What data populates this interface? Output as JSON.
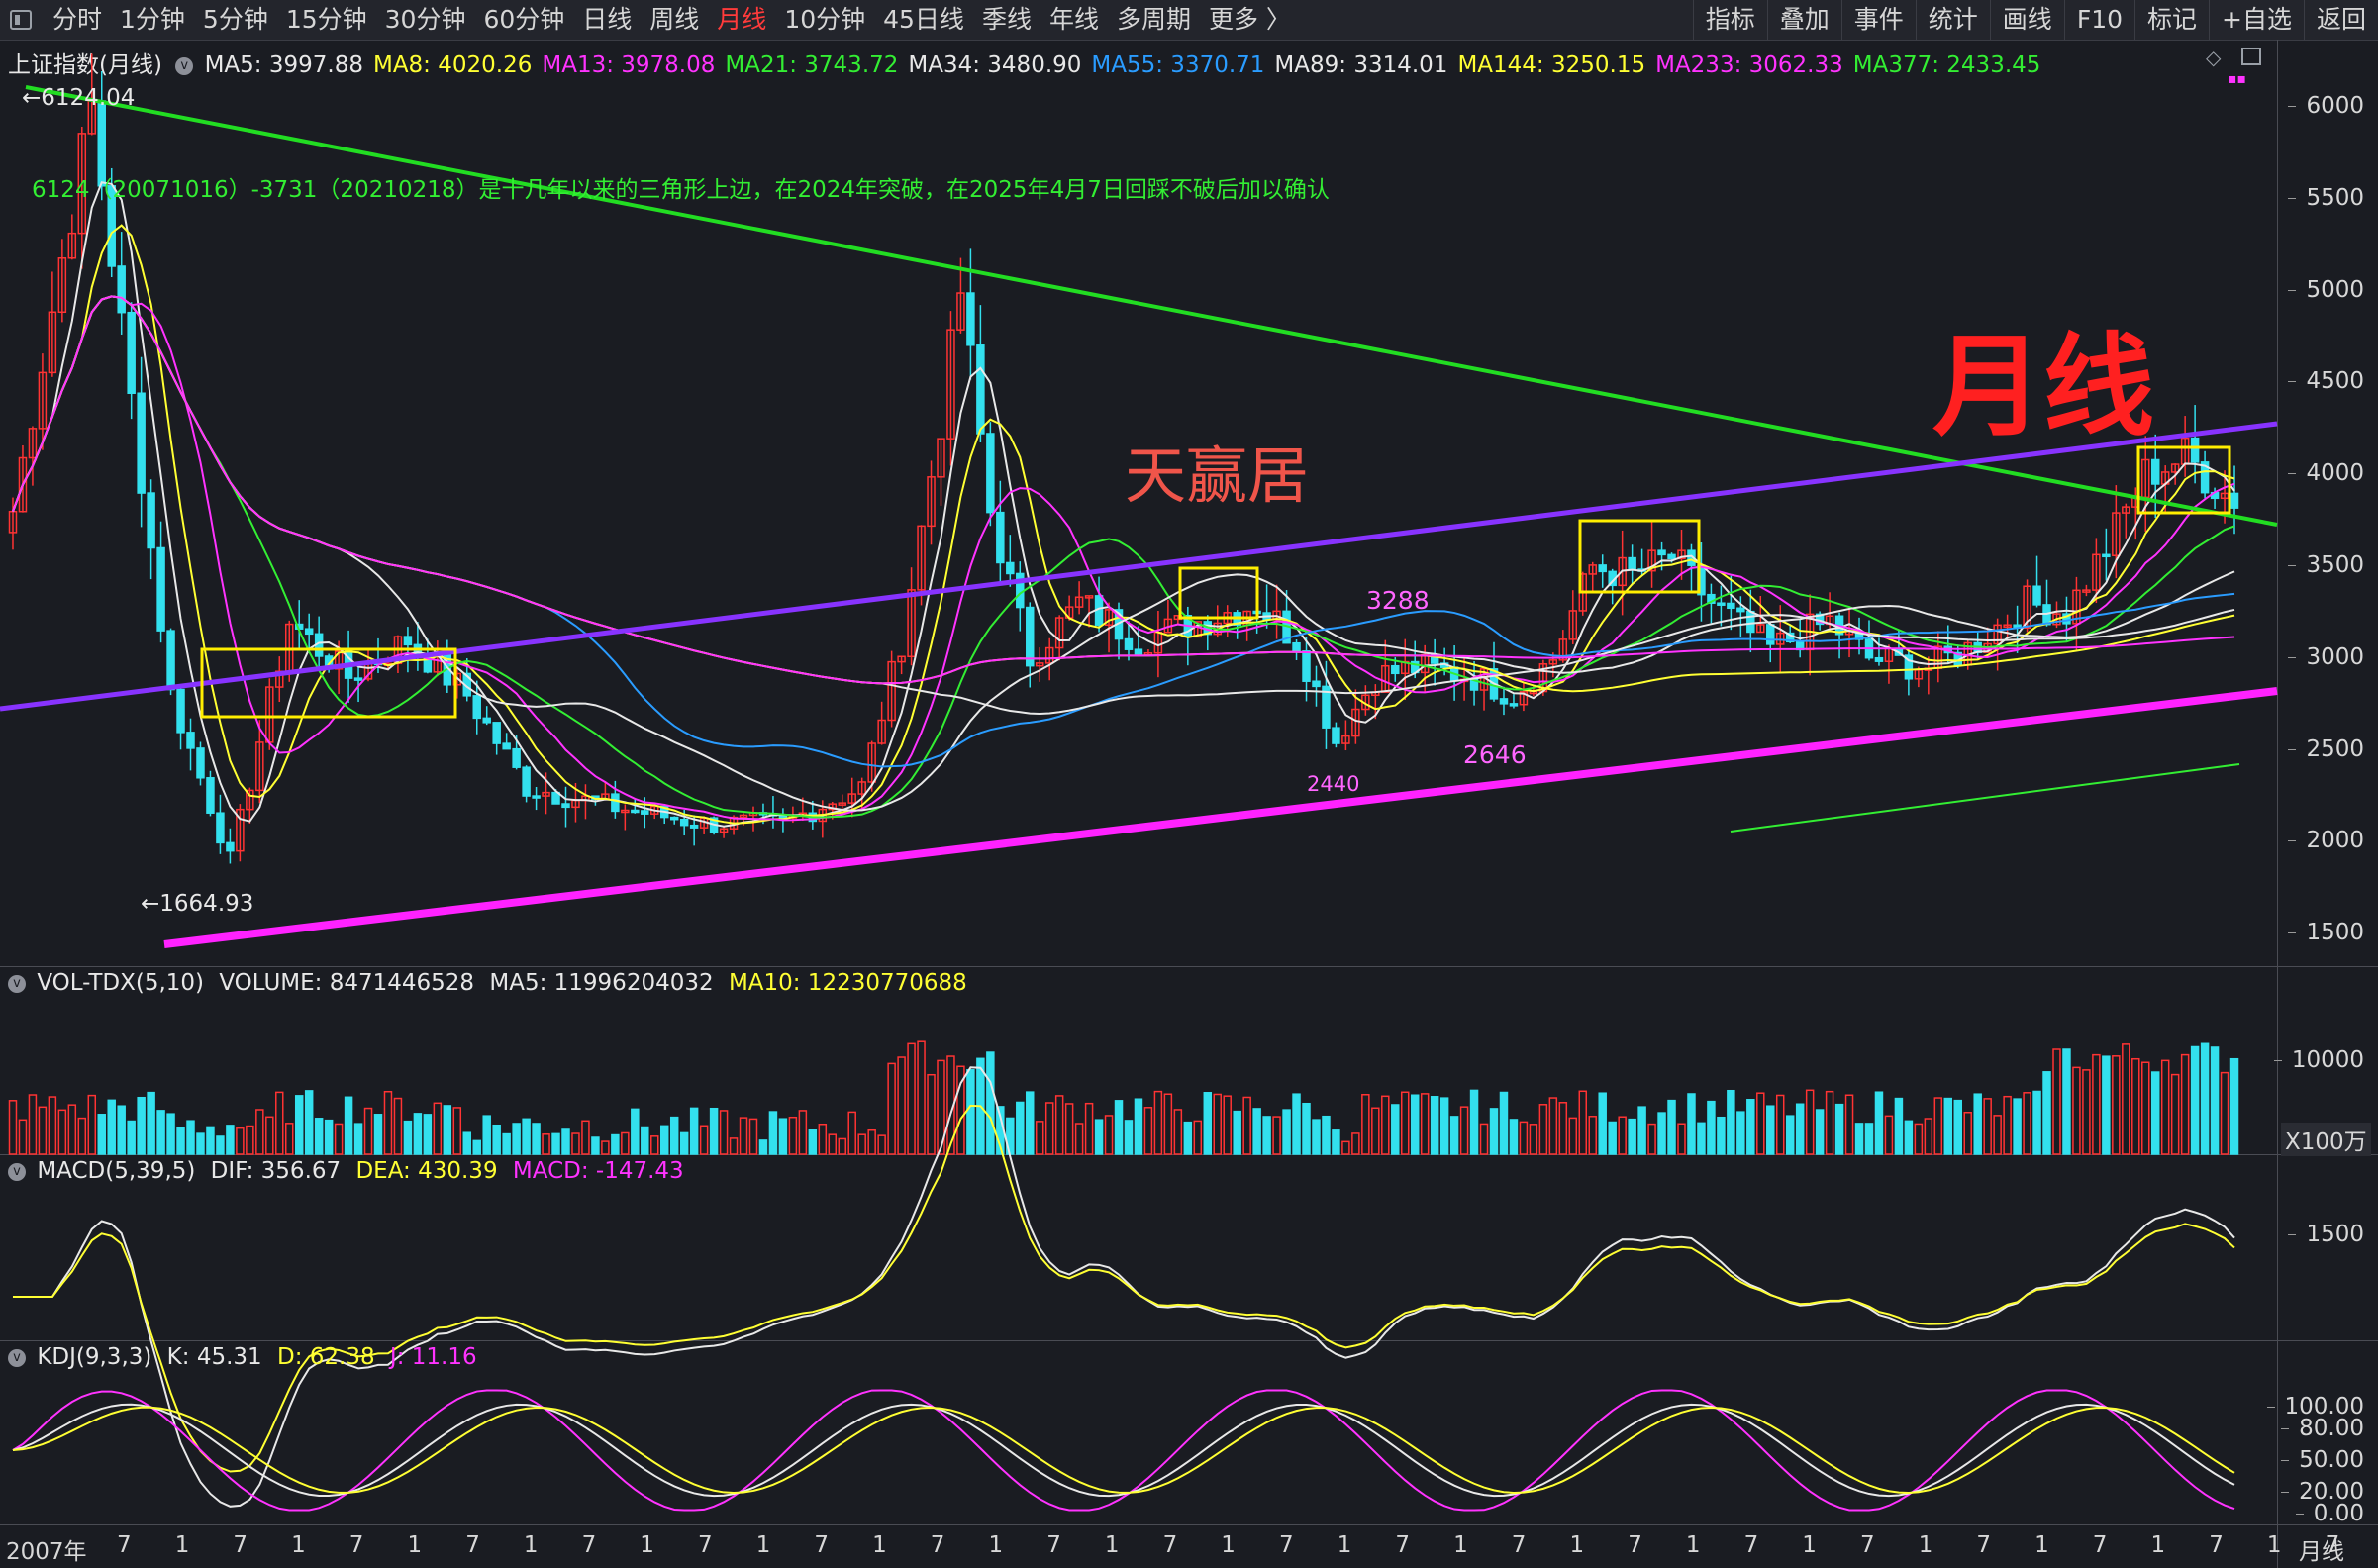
{
  "tabs": [
    "分时",
    "1分钟",
    "5分钟",
    "15分钟",
    "30分钟",
    "60分钟",
    "日线",
    "周线",
    "月线",
    "10分钟",
    "45日线",
    "季线",
    "年线",
    "多周期",
    "更多 〉"
  ],
  "active_tab": "月线",
  "tools": [
    "指标",
    "叠加",
    "事件",
    "统计",
    "画线",
    "F10",
    "标记",
    "+自选",
    "返回"
  ],
  "main": {
    "name": "上证指数(月线)",
    "ma": [
      {
        "t": "MA5: 3997.88",
        "c": "#e8e8e8"
      },
      {
        "t": "MA8: 4020.26",
        "c": "#ffff33"
      },
      {
        "t": "MA13: 3978.08",
        "c": "#ff33ff"
      },
      {
        "t": "MA21: 3743.72",
        "c": "#33ee33"
      },
      {
        "t": "MA34: 3480.90",
        "c": "#e8e8e8"
      },
      {
        "t": "MA55: 3370.71",
        "c": "#2a9cff"
      },
      {
        "t": "MA89: 3314.01",
        "c": "#e8e8e8"
      },
      {
        "t": "MA144: 3250.15",
        "c": "#ffff33"
      },
      {
        "t": "MA233: 3062.33",
        "c": "#ff33ff"
      },
      {
        "t": "MA377: 2433.45",
        "c": "#33ee33"
      }
    ],
    "y_ticks": [
      "6000",
      "5500",
      "5000",
      "4500",
      "4000",
      "3500",
      "3000",
      "2500",
      "2000",
      "1500"
    ],
    "ann_high": "6124.04",
    "ann_low": "1664.93",
    "ann_text": "6124（20071016）-3731（20210218）是十几年以来的三角形上边，在2024年突破，在2025年4月7日回踩不破后加以确认",
    "label_3288": "3288",
    "label_2440": "2440",
    "label_2646": "2646",
    "watermark": "天赢居",
    "big_label": "月线",
    "colors": {
      "up": "#ff3333",
      "down": "#33e0ee",
      "green_line": "#22dd22",
      "purple_line": "#8833ff",
      "magenta_line": "#ff22ff",
      "box": "#ffee00"
    }
  },
  "vol": {
    "title": "VOL-TDX(5,10)",
    "volume": "VOLUME: 8471446528",
    "ma5": "MA5: 11996204032",
    "ma10": "MA10: 12230770688",
    "tick": "10000",
    "unit": "X100万"
  },
  "macd": {
    "title": "MACD(5,39,5)",
    "dif": "DIF: 356.67",
    "dea": "DEA: 430.39",
    "macd": "MACD: -147.43",
    "tick": "1500"
  },
  "kdj": {
    "title": "KDJ(9,3,3)",
    "k": "K: 45.31",
    "d": "D: 62.38",
    "j": "J: 11.16",
    "ticks": [
      "100.00",
      "80.00",
      "50.00",
      "20.00",
      "0.00"
    ]
  },
  "x_labels": [
    "2007年",
    "7",
    "1",
    "7",
    "1",
    "7",
    "1",
    "7",
    "1",
    "7",
    "1",
    "7",
    "1",
    "7",
    "1",
    "7",
    "1",
    "7",
    "1",
    "7",
    "1",
    "7",
    "1",
    "7",
    "1",
    "7",
    "1",
    "7",
    "1",
    "7",
    "1",
    "7",
    "1",
    "7",
    "1",
    "7",
    "1",
    "7",
    "1",
    "7"
  ],
  "footer_label": "月线"
}
